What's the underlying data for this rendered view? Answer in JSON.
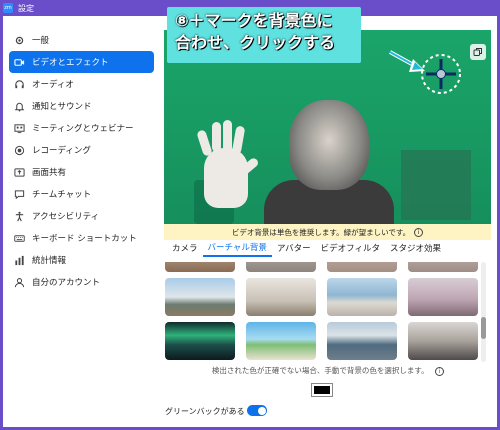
{
  "window": {
    "title": "設定",
    "app_icon": "zoom"
  },
  "sidebar": {
    "items": [
      {
        "label": "一般",
        "icon": "gear-icon"
      },
      {
        "label": "ビデオとエフェクト",
        "icon": "video-camera-icon",
        "active": true
      },
      {
        "label": "オーディオ",
        "icon": "headphones-icon"
      },
      {
        "label": "通知とサウンド",
        "icon": "bell-icon"
      },
      {
        "label": "ミーティングとウェビナー",
        "icon": "meeting-icon"
      },
      {
        "label": "レコーディング",
        "icon": "record-icon"
      },
      {
        "label": "画面共有",
        "icon": "screen-share-icon"
      },
      {
        "label": "チームチャット",
        "icon": "chat-icon"
      },
      {
        "label": "アクセシビリティ",
        "icon": "accessibility-icon"
      },
      {
        "label": "キーボード ショートカット",
        "icon": "keyboard-icon"
      },
      {
        "label": "統計情報",
        "icon": "statistics-icon"
      },
      {
        "label": "自分のアカウント",
        "icon": "user-icon"
      }
    ]
  },
  "preview": {
    "annotation_line1": "⑧＋マークを背景色に",
    "annotation_line2": "合わせ、クリックする",
    "note": "ビデオ背景は単色を推奨します。緑が望ましいです。"
  },
  "tabs": [
    {
      "label": "カメラ"
    },
    {
      "label": "バーチャル背景",
      "active": true
    },
    {
      "label": "アバター"
    },
    {
      "label": "ビデオフィルタ"
    },
    {
      "label": "スタジオ効果"
    }
  ],
  "backgrounds": {
    "note": "検出された色が正確でない場合、手動で背景の色を選択します。",
    "selected_color": "#000000"
  },
  "green_screen": {
    "label": "グリーンバックがある",
    "enabled": true
  },
  "colors": {
    "accent": "#0e72ed",
    "frame": "#6a4ec9",
    "annotation_bg": "#5fe1e0",
    "note_bg": "#fdf3c3"
  }
}
